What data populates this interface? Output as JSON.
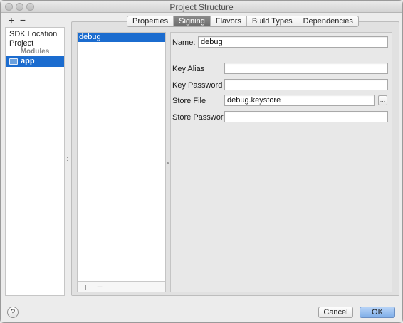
{
  "window": {
    "title": "Project Structure"
  },
  "sidebar": {
    "add_label": "+",
    "remove_label": "−",
    "items": [
      {
        "label": "SDK Location"
      },
      {
        "label": "Project"
      }
    ],
    "section_label": "Modules",
    "modules": [
      {
        "label": "app",
        "icon": "folder-module-icon",
        "selected": true
      }
    ]
  },
  "tabs": [
    {
      "label": "Properties",
      "active": false
    },
    {
      "label": "Signing",
      "active": true
    },
    {
      "label": "Flavors",
      "active": false
    },
    {
      "label": "Build Types",
      "active": false
    },
    {
      "label": "Dependencies",
      "active": false
    }
  ],
  "signing": {
    "configs": [
      {
        "label": "debug",
        "selected": true
      }
    ],
    "add_label": "+",
    "remove_label": "−",
    "name_label": "Name:",
    "name_value": "debug",
    "key_alias_label": "Key Alias",
    "key_alias_value": "",
    "key_password_label": "Key Password",
    "key_password_value": "",
    "store_file_label": "Store File",
    "store_file_value": "debug.keystore",
    "browse_label": "...",
    "store_password_label": "Store Password",
    "store_password_value": ""
  },
  "footer": {
    "help_label": "?",
    "cancel_label": "Cancel",
    "ok_label": "OK"
  },
  "colors": {
    "selection": "#1b6ccf",
    "default_button": "#7faee8"
  }
}
